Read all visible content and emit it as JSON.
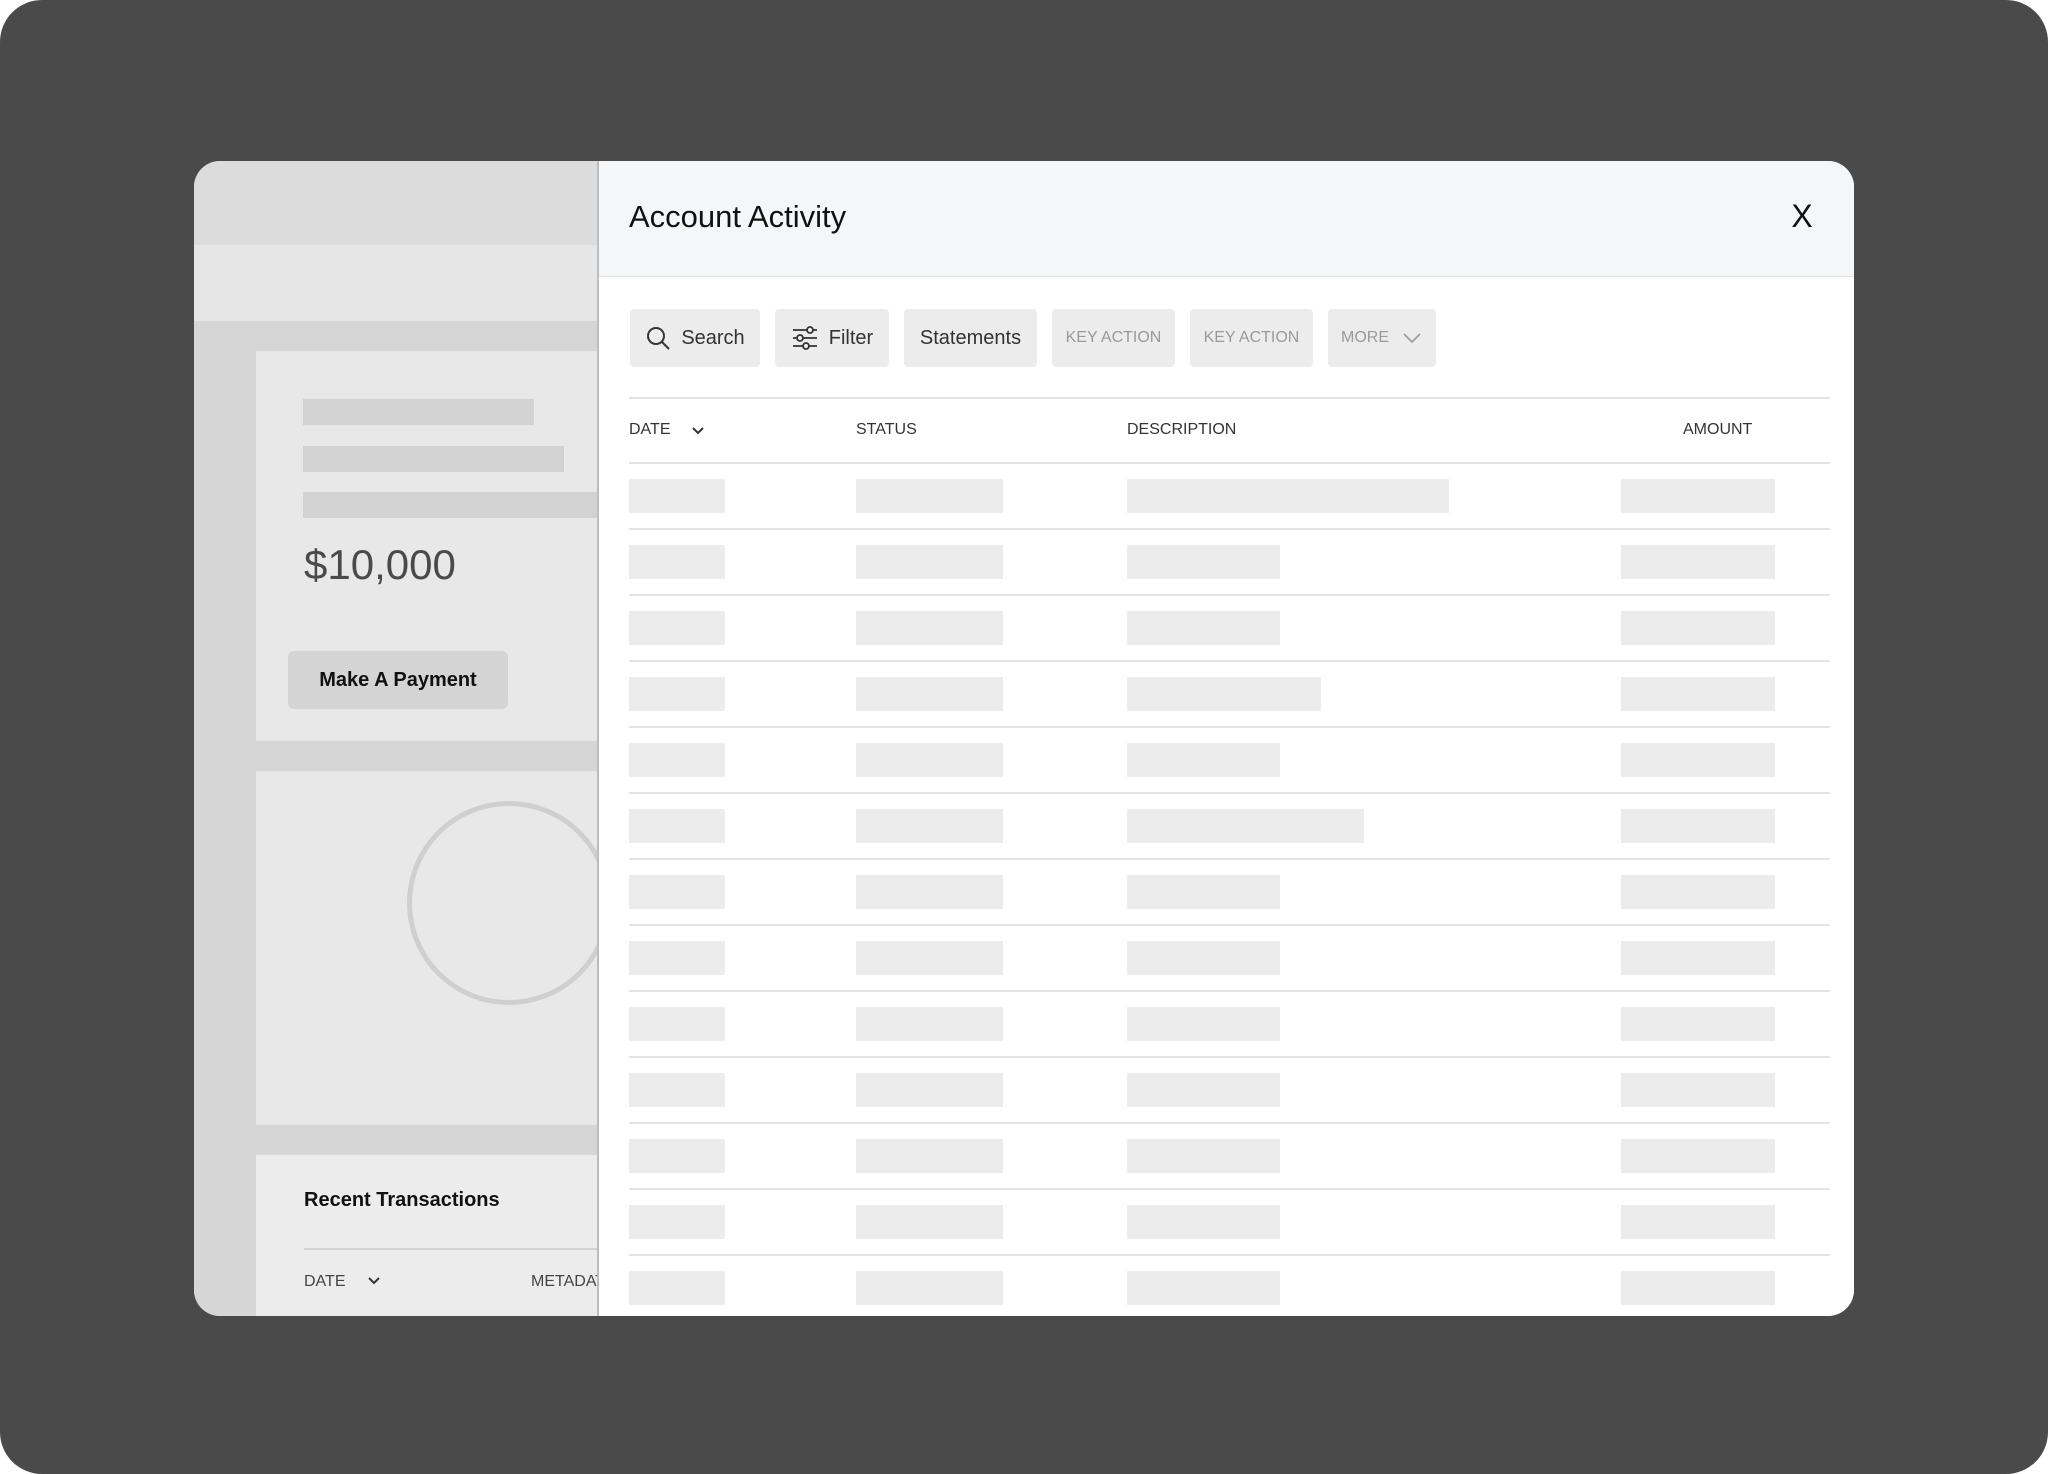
{
  "background_page": {
    "balance": "$10,000",
    "payment_button": "Make A Payment",
    "recent_transactions": {
      "title": "Recent Transactions",
      "columns": [
        "DATE",
        "METADATA"
      ]
    }
  },
  "modal": {
    "title": "Account Activity",
    "close_label": "X",
    "toolbar": {
      "search": "Search",
      "filter": "Filter",
      "statements": "Statements",
      "key_action_1": "KEY ACTION",
      "key_action_2": "KEY ACTION",
      "more": "MORE"
    },
    "table": {
      "columns": {
        "date": "DATE",
        "status": "STATUS",
        "description": "DESCRIPTION",
        "amount": "AMOUNT"
      },
      "sort_column": "date",
      "row_count": 13
    }
  },
  "colors": {
    "outer_frame": "#4a4a4a",
    "panel_header": "#f5f6f7",
    "skeleton": "#ececec"
  }
}
